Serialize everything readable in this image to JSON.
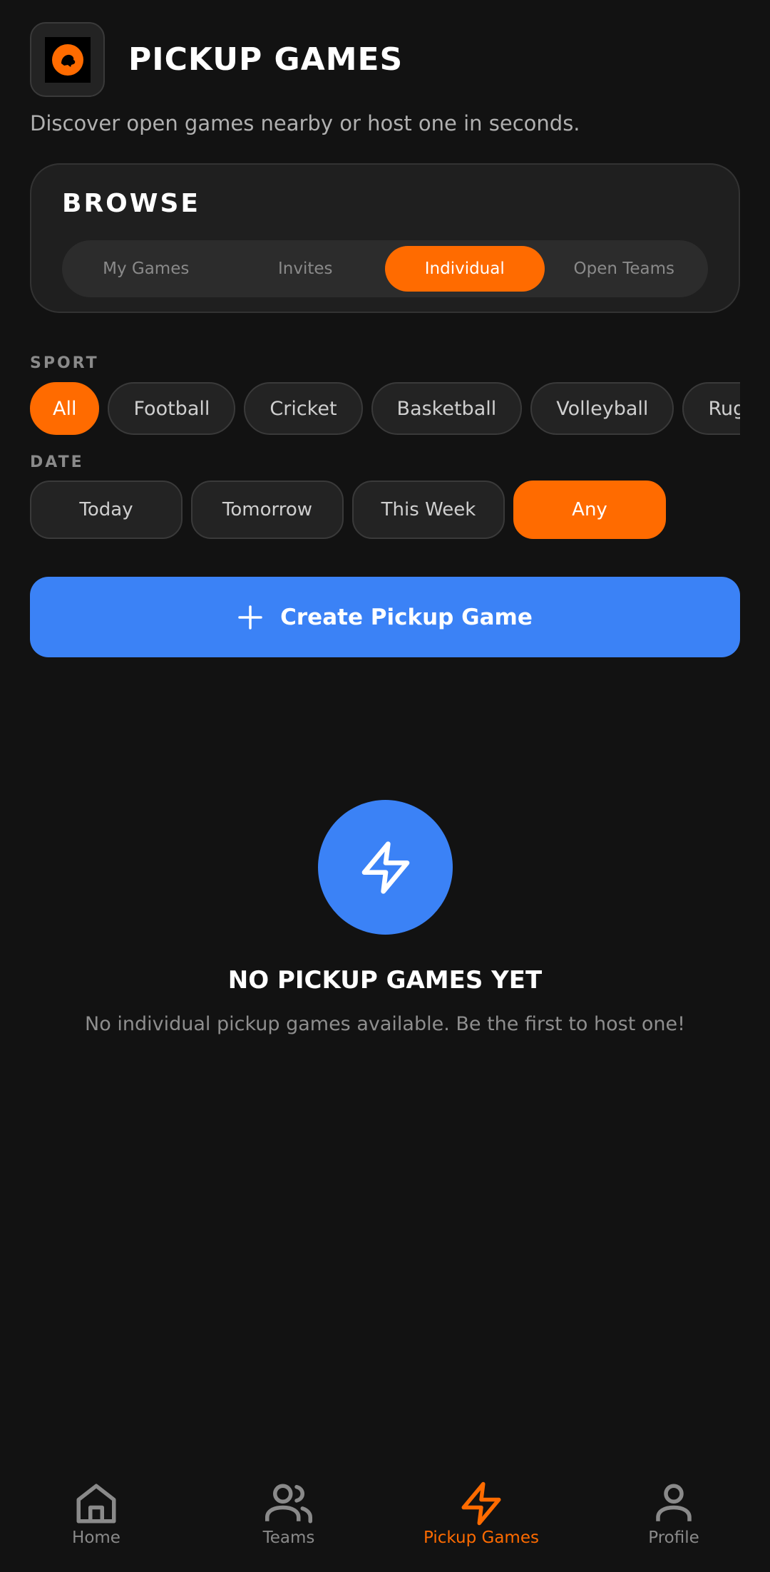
{
  "header": {
    "title": "PICKUP GAMES",
    "subtitle": "Discover open games nearby or host one in seconds.",
    "logo_icon": "mascot-logo-icon"
  },
  "browse": {
    "title": "BROWSE",
    "tabs": [
      {
        "label": "My Games",
        "active": false
      },
      {
        "label": "Invites",
        "active": false
      },
      {
        "label": "Individual",
        "active": true
      },
      {
        "label": "Open Teams",
        "active": false
      }
    ]
  },
  "sport": {
    "label": "SPORT",
    "chips": [
      {
        "label": "All",
        "active": true
      },
      {
        "label": "Football",
        "active": false
      },
      {
        "label": "Cricket",
        "active": false
      },
      {
        "label": "Basketball",
        "active": false
      },
      {
        "label": "Volleyball",
        "active": false
      },
      {
        "label": "Rugby/Am",
        "active": false
      }
    ]
  },
  "date": {
    "label": "DATE",
    "chips": [
      {
        "label": "Today",
        "active": false
      },
      {
        "label": "Tomorrow",
        "active": false
      },
      {
        "label": "This Week",
        "active": false
      },
      {
        "label": "Any",
        "active": true
      }
    ]
  },
  "create_button": {
    "label": "Create Pickup Game",
    "icon": "plus-icon"
  },
  "empty_state": {
    "icon": "lightning-icon",
    "title": "NO PICKUP GAMES YET",
    "description": "No individual pickup games available. Be the first to host one!"
  },
  "tabbar": [
    {
      "label": "Home",
      "icon": "home-icon",
      "active": false
    },
    {
      "label": "Teams",
      "icon": "teams-icon",
      "active": false
    },
    {
      "label": "Pickup Games",
      "icon": "lightning-icon",
      "active": true
    },
    {
      "label": "Profile",
      "icon": "profile-icon",
      "active": false
    }
  ],
  "colors": {
    "accent": "#ff6b00",
    "primary": "#3b82f6",
    "background": "#121212"
  }
}
